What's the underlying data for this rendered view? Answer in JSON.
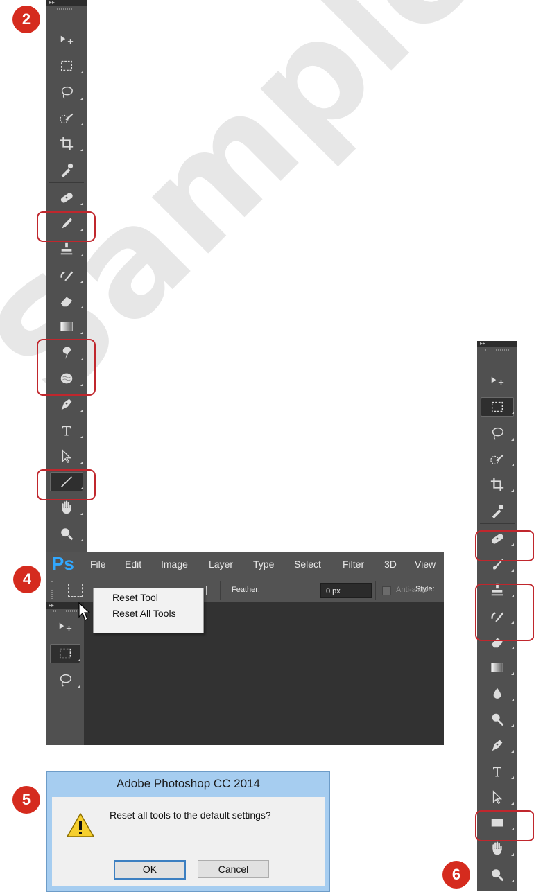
{
  "watermark": "Sample",
  "steps": {
    "s2": "2",
    "s4": "4",
    "s5": "5",
    "s6": "6"
  },
  "colors": {
    "step_badge": "#d52b1e",
    "highlight": "#c0272d",
    "toolbar": "#505050",
    "ps_logo": "#31a8ff",
    "dialog_frame": "#a6cdf0"
  },
  "toolbar_left": {
    "collapse_glyph": "▸▸",
    "tools": [
      "move-icon",
      "rect-marquee-icon",
      "lasso-icon",
      "quick-selection-icon",
      "crop-icon",
      "eyedropper-icon",
      "healing-brush-icon",
      "pencil-icon",
      "clone-stamp-icon",
      "history-brush-icon",
      "eraser-icon",
      "gradient-icon",
      "smudge-icon",
      "sponge-icon",
      "pen-icon",
      "type-icon",
      "path-selection-icon",
      "line-icon",
      "hand-icon",
      "zoom-icon"
    ],
    "highlighted": [
      "pencil-icon",
      "smudge-icon",
      "sponge-icon",
      "line-icon"
    ]
  },
  "toolbar_right": {
    "collapse_glyph": "▸▸",
    "tools": [
      "move-icon",
      "rect-marquee-icon",
      "lasso-icon",
      "quick-selection-icon",
      "crop-icon",
      "eyedropper-icon",
      "healing-brush-icon",
      "brush-icon",
      "clone-stamp-icon",
      "history-brush-icon",
      "eraser-icon",
      "gradient-icon",
      "blur-icon",
      "dodge-icon",
      "pen-icon",
      "type-icon",
      "path-selection-icon",
      "rectangle-icon",
      "hand-icon",
      "zoom-icon"
    ],
    "highlighted": [
      "brush-icon",
      "blur-icon",
      "dodge-icon",
      "rectangle-icon"
    ]
  },
  "photoshop": {
    "logo": "Ps",
    "menu": [
      "File",
      "Edit",
      "Image",
      "Layer",
      "Type",
      "Select",
      "Filter",
      "3D",
      "View"
    ],
    "options": {
      "feather_label": "Feather:",
      "feather_value": "0 px",
      "antialias_label": "Anti-alias",
      "style_label": "Style:"
    },
    "context_menu": [
      "Reset Tool",
      "Reset All Tools"
    ]
  },
  "dialog": {
    "title": "Adobe Photoshop CC 2014",
    "message": "Reset all tools to the default settings?",
    "ok": "OK",
    "cancel": "Cancel"
  }
}
